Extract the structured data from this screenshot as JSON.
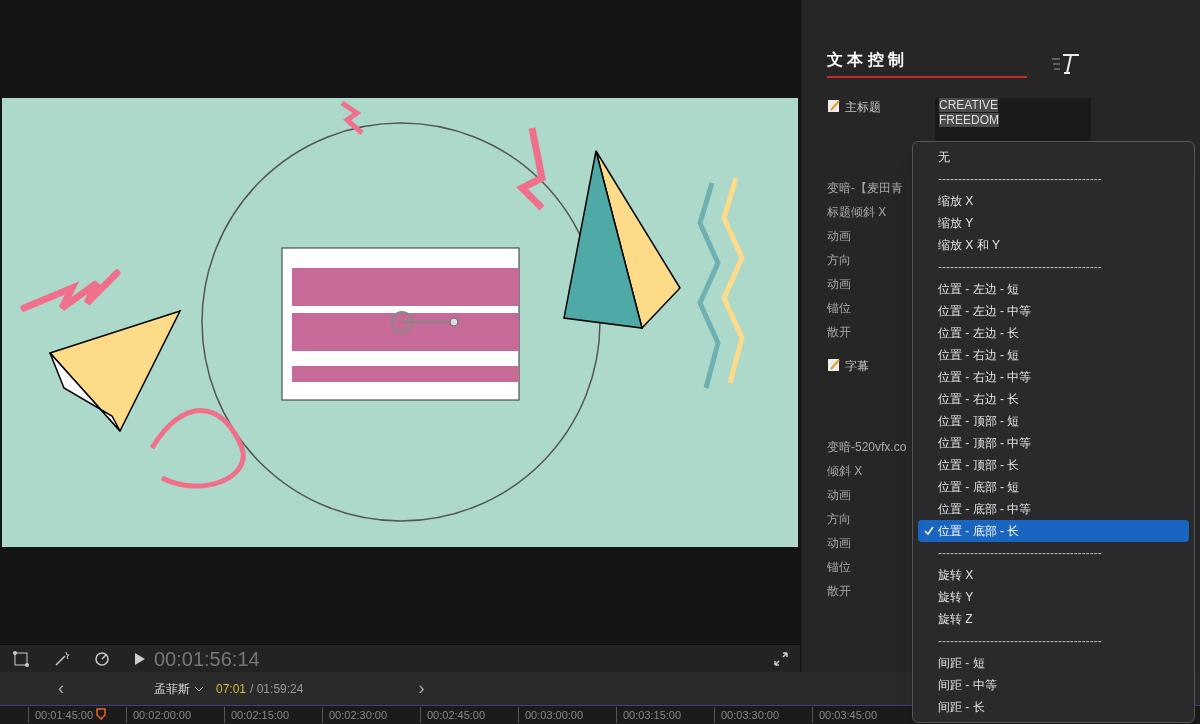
{
  "viewer": {
    "timecode": "00:01:56:14"
  },
  "inspector": {
    "title": "文 本 控 制",
    "sections": [
      {
        "label": "主标题",
        "value": "CREATIVE\nFREEDOM",
        "params": [
          "变暗-【麦田青",
          "标题倾斜 X",
          "动画",
          "方向",
          "动画",
          "锚位",
          "散开"
        ]
      },
      {
        "label": "字幕",
        "params": [
          "变暗-520vfx.co",
          "倾斜 X",
          "动画",
          "方向",
          "动画",
          "锚位",
          "散开"
        ]
      }
    ]
  },
  "menu": [
    {
      "kind": "item",
      "label": "无",
      "selected": false
    },
    {
      "kind": "separator",
      "label": "-----------------------------------------"
    },
    {
      "kind": "item",
      "label": "缩放 X",
      "selected": false
    },
    {
      "kind": "item",
      "label": "缩放 Y",
      "selected": false
    },
    {
      "kind": "item",
      "label": "缩放 X 和 Y",
      "selected": false
    },
    {
      "kind": "separator",
      "label": "-----------------------------------------"
    },
    {
      "kind": "item",
      "label": "位置 - 左边 - 短",
      "selected": false
    },
    {
      "kind": "item",
      "label": "位置 - 左边 - 中等",
      "selected": false
    },
    {
      "kind": "item",
      "label": "位置 - 左边 - 长",
      "selected": false
    },
    {
      "kind": "item",
      "label": "位置 - 右边 - 短",
      "selected": false
    },
    {
      "kind": "item",
      "label": "位置 - 右边 - 中等",
      "selected": false
    },
    {
      "kind": "item",
      "label": "位置 - 右边 - 长",
      "selected": false
    },
    {
      "kind": "item",
      "label": "位置 - 顶部 - 短",
      "selected": false
    },
    {
      "kind": "item",
      "label": "位置 - 顶部 - 中等",
      "selected": false
    },
    {
      "kind": "item",
      "label": "位置 - 顶部 - 长",
      "selected": false
    },
    {
      "kind": "item",
      "label": "位置 - 底部 - 短",
      "selected": false
    },
    {
      "kind": "item",
      "label": "位置 - 底部 - 中等",
      "selected": false
    },
    {
      "kind": "item",
      "label": "位置 - 底部 - 长",
      "selected": true
    },
    {
      "kind": "separator",
      "label": "-----------------------------------------"
    },
    {
      "kind": "item",
      "label": "旋转 X",
      "selected": false
    },
    {
      "kind": "item",
      "label": "旋转 Y",
      "selected": false
    },
    {
      "kind": "item",
      "label": "旋转 Z",
      "selected": false
    },
    {
      "kind": "separator",
      "label": "-----------------------------------------"
    },
    {
      "kind": "item",
      "label": "间距 - 短",
      "selected": false
    },
    {
      "kind": "item",
      "label": "间距 - 中等",
      "selected": false
    },
    {
      "kind": "item",
      "label": "间距 - 长",
      "selected": false
    }
  ],
  "timeline_nav": {
    "prev": "‹",
    "project": "孟菲斯",
    "current": "07:01",
    "total": "/ 01:59:24",
    "next": "›"
  },
  "ruler": [
    "00:01:45:00",
    "00:02:00:00",
    "00:02:15:00",
    "00:02:30:00",
    "00:02:45:00",
    "00:03:00:00",
    "00:03:15:00",
    "00:03:30:00",
    "00:03:45:00"
  ]
}
